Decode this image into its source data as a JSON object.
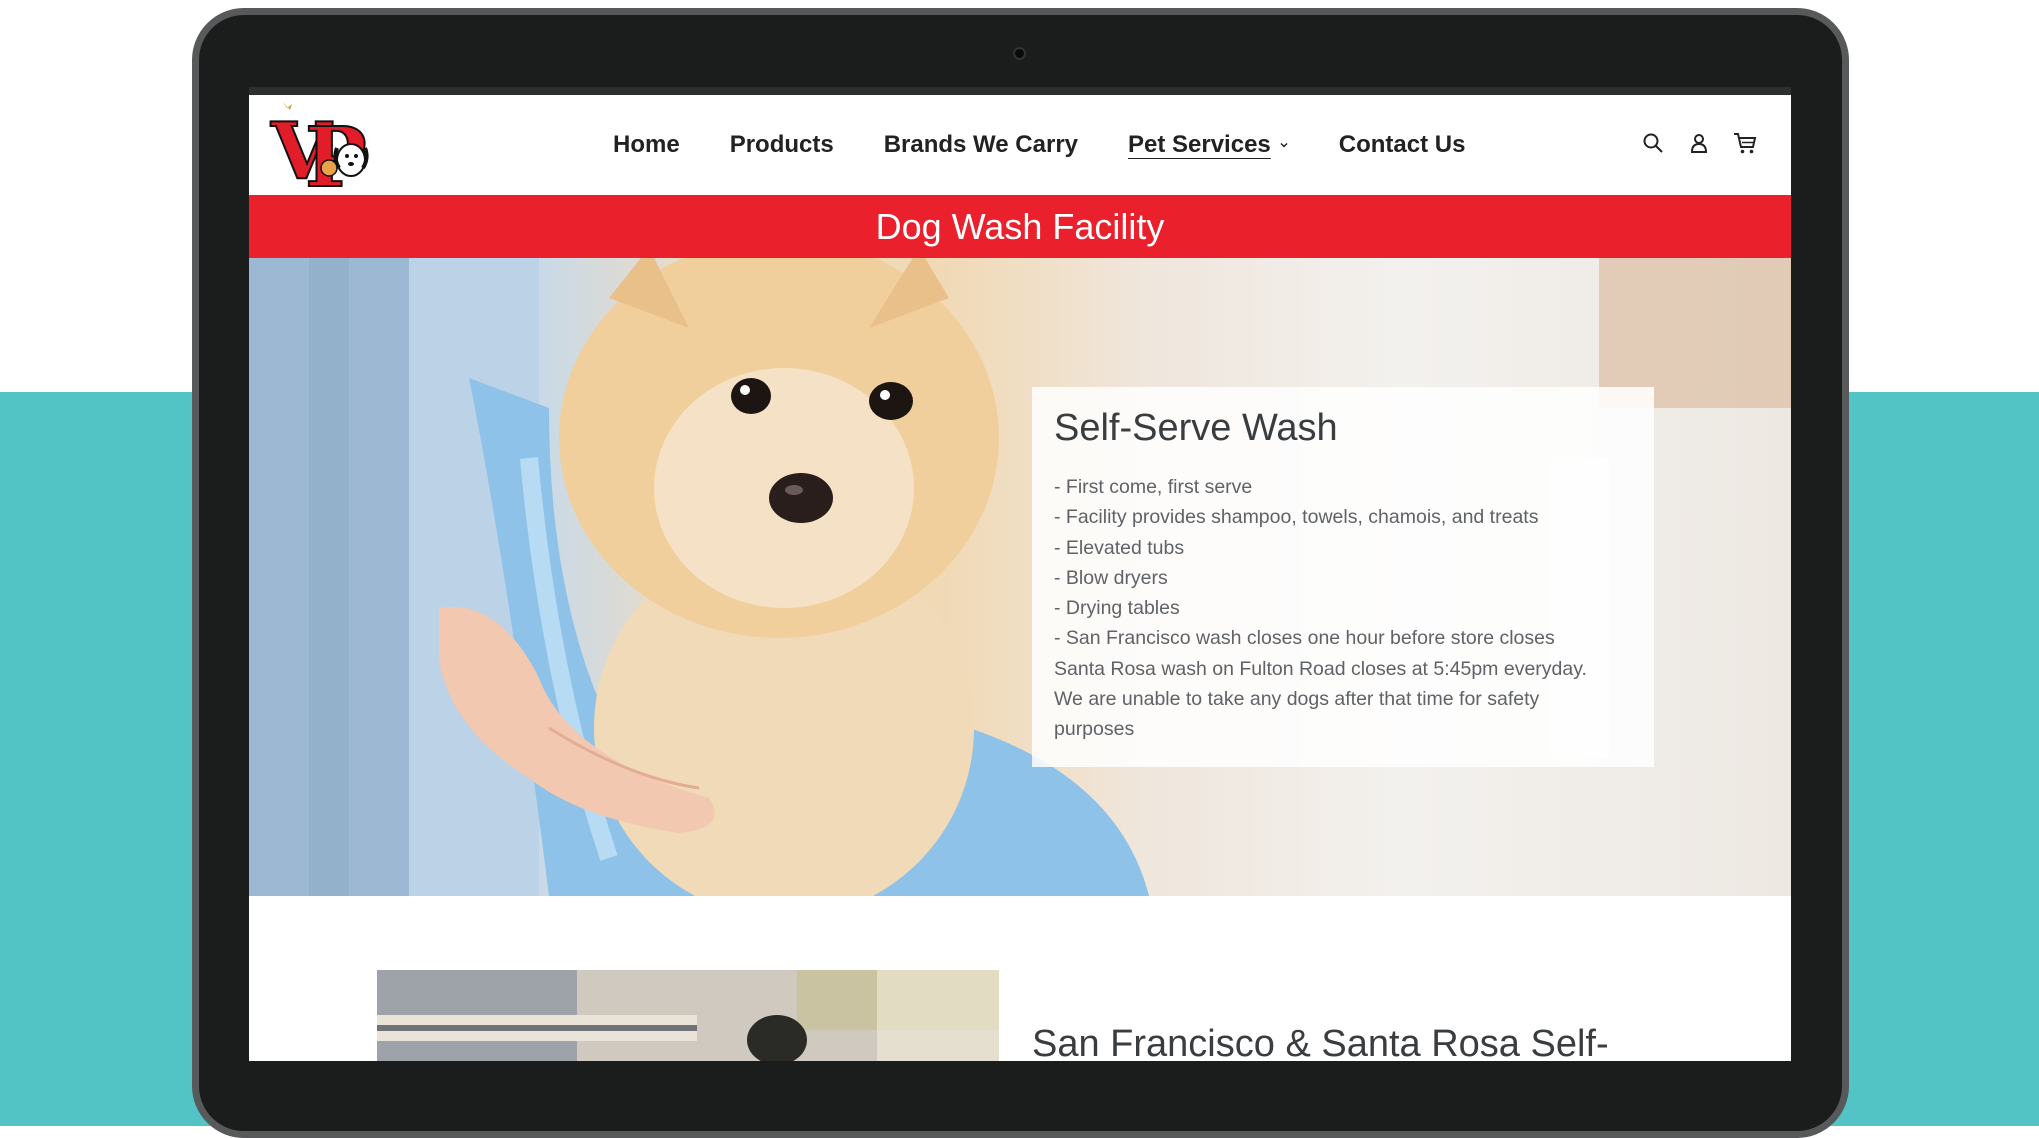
{
  "nav": {
    "items": [
      {
        "label": "Home"
      },
      {
        "label": "Products"
      },
      {
        "label": "Brands We Carry"
      },
      {
        "label": "Pet Services"
      },
      {
        "label": "Contact Us"
      }
    ]
  },
  "header_icons": [
    "search-icon",
    "account-icon",
    "cart-icon"
  ],
  "logo_text": "VP",
  "banner": {
    "title": "Dog Wash Facility"
  },
  "hero_card": {
    "title": "Self-Serve Wash",
    "lines": [
      "- First come, first serve",
      "- Facility provides shampoo, towels, chamois, and treats",
      "- Elevated tubs",
      "- Blow dryers",
      "- Drying tables",
      "- San Francisco wash closes one hour before store closes",
      "Santa Rosa wash on Fulton Road closes at 5:45pm everyday.",
      "We are unable to take any dogs after that time for safety",
      "purposes"
    ]
  },
  "lower_section": {
    "heading": "San Francisco & Santa Rosa Self-"
  },
  "colors": {
    "brand_red": "#ea202c",
    "teal": "#52c4c5",
    "device": "#1b1c1c"
  }
}
